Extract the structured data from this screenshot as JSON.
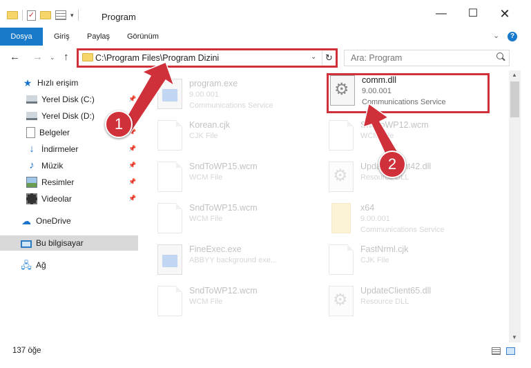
{
  "window": {
    "title": "Program",
    "controls": {
      "minimize": "—",
      "maximize": "☐",
      "close": "✕"
    }
  },
  "ribbon": {
    "tabs": [
      "Dosya",
      "Giriş",
      "Paylaş",
      "Görünüm"
    ],
    "help": "?"
  },
  "address_bar": {
    "path": "C:\\Program Files\\Program Dizini",
    "refresh": "↻"
  },
  "search": {
    "placeholder": "Ara: Program"
  },
  "sidebar": {
    "items": [
      {
        "label": "Hızlı erişim",
        "icon": "star-icon",
        "pinned": false
      },
      {
        "label": "Yerel Disk (C:)",
        "icon": "drive-icon",
        "pinned": true
      },
      {
        "label": "Yerel Disk (D:)",
        "icon": "drive-icon",
        "pinned": true
      },
      {
        "label": "Belgeler",
        "icon": "document-icon",
        "pinned": true
      },
      {
        "label": "İndirmeler",
        "icon": "download-icon",
        "pinned": true
      },
      {
        "label": "Müzik",
        "icon": "music-icon",
        "pinned": true
      },
      {
        "label": "Resimler",
        "icon": "pictures-icon",
        "pinned": true
      },
      {
        "label": "Videolar",
        "icon": "video-icon",
        "pinned": true
      },
      {
        "label": "OneDrive",
        "icon": "cloud-icon",
        "pinned": false
      },
      {
        "label": "Bu bilgisayar",
        "icon": "computer-icon",
        "pinned": false,
        "selected": true
      },
      {
        "label": "Ağ",
        "icon": "network-icon",
        "pinned": false
      }
    ]
  },
  "files": [
    {
      "name": "program.exe",
      "line1": "9.00.001",
      "line2": "Communications Service",
      "icon": "application-icon",
      "faded": true
    },
    {
      "name": "comm.dll",
      "line1": "9.00.001",
      "line2": "Communications Service",
      "icon": "gear-file-icon",
      "faded": false,
      "highlighted": true
    },
    {
      "name": "Korean.cjk",
      "line1": "CJK File",
      "line2": "",
      "icon": "file-icon",
      "faded": true
    },
    {
      "name": "SndToWP12.wcm",
      "line1": "WCM File",
      "line2": "",
      "icon": "file-icon",
      "faded": true
    },
    {
      "name": "SndToWP15.wcm",
      "line1": "WCM File",
      "line2": "",
      "icon": "file-icon",
      "faded": true
    },
    {
      "name": "UpdateClient42.dll",
      "line1": "Resource DLL",
      "line2": "",
      "icon": "gear-file-icon",
      "faded": true
    },
    {
      "name": "SndToWP15.wcm",
      "line1": "WCM File",
      "line2": "",
      "icon": "file-icon",
      "faded": true
    },
    {
      "name": "x64",
      "line1": "9.00.001",
      "line2": "Communications Service",
      "icon": "folder-icon",
      "faded": true
    },
    {
      "name": "FineExec.exe",
      "line1": "ABBYY background exe...",
      "line2": "",
      "icon": "application-icon",
      "faded": true
    },
    {
      "name": "FastNrml.cjk",
      "line1": "CJK File",
      "line2": "",
      "icon": "file-icon",
      "faded": true
    },
    {
      "name": "SndToWP12.wcm",
      "line1": "WCM File",
      "line2": "",
      "icon": "file-icon",
      "faded": true
    },
    {
      "name": "UpdateClient65.dll",
      "line1": "Resource DLL",
      "line2": "",
      "icon": "gear-file-icon",
      "faded": true
    }
  ],
  "status": {
    "item_count": "137 öğe"
  },
  "annotations": {
    "badge1": "1",
    "badge2": "2",
    "color": "#d0303a"
  },
  "colors": {
    "accent": "#1979ca",
    "highlight": "#d0303a"
  }
}
